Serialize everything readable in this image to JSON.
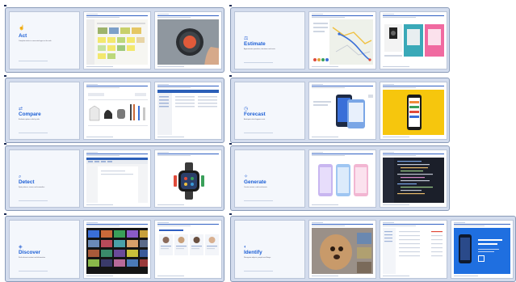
{
  "sections": [
    {
      "id": "act",
      "title": "Act",
      "icon": "pointer-hand-icon",
      "description": "Complete tasks in connected apps or the web"
    },
    {
      "id": "estimate",
      "title": "Estimate",
      "icon": "scale-icon",
      "description": "Approximate quantities, durations and costs"
    },
    {
      "id": "compare",
      "title": "Compare",
      "icon": "compare-icon",
      "description": "Evaluate options side by side"
    },
    {
      "id": "forecast",
      "title": "Forecast",
      "icon": "clock-icon",
      "description": "Anticipate what happens next"
    },
    {
      "id": "detect",
      "title": "Detect",
      "icon": "detect-icon",
      "description": "Spot patterns, issues and anomalies"
    },
    {
      "id": "generate",
      "title": "Generate",
      "icon": "sparkle-icon",
      "description": "Create content, code and assets"
    },
    {
      "id": "discover",
      "title": "Discover",
      "icon": "compass-icon",
      "description": "Find relevant content and information"
    },
    {
      "id": "identify",
      "title": "Identify",
      "icon": "person-icon",
      "description": "Recognize objects, people and things"
    }
  ],
  "colors": {
    "section_bg": "#d3dced",
    "section_border": "#8a9bb8",
    "title_blue": "#1c5fd6",
    "slide_bg": "#ffffff"
  }
}
